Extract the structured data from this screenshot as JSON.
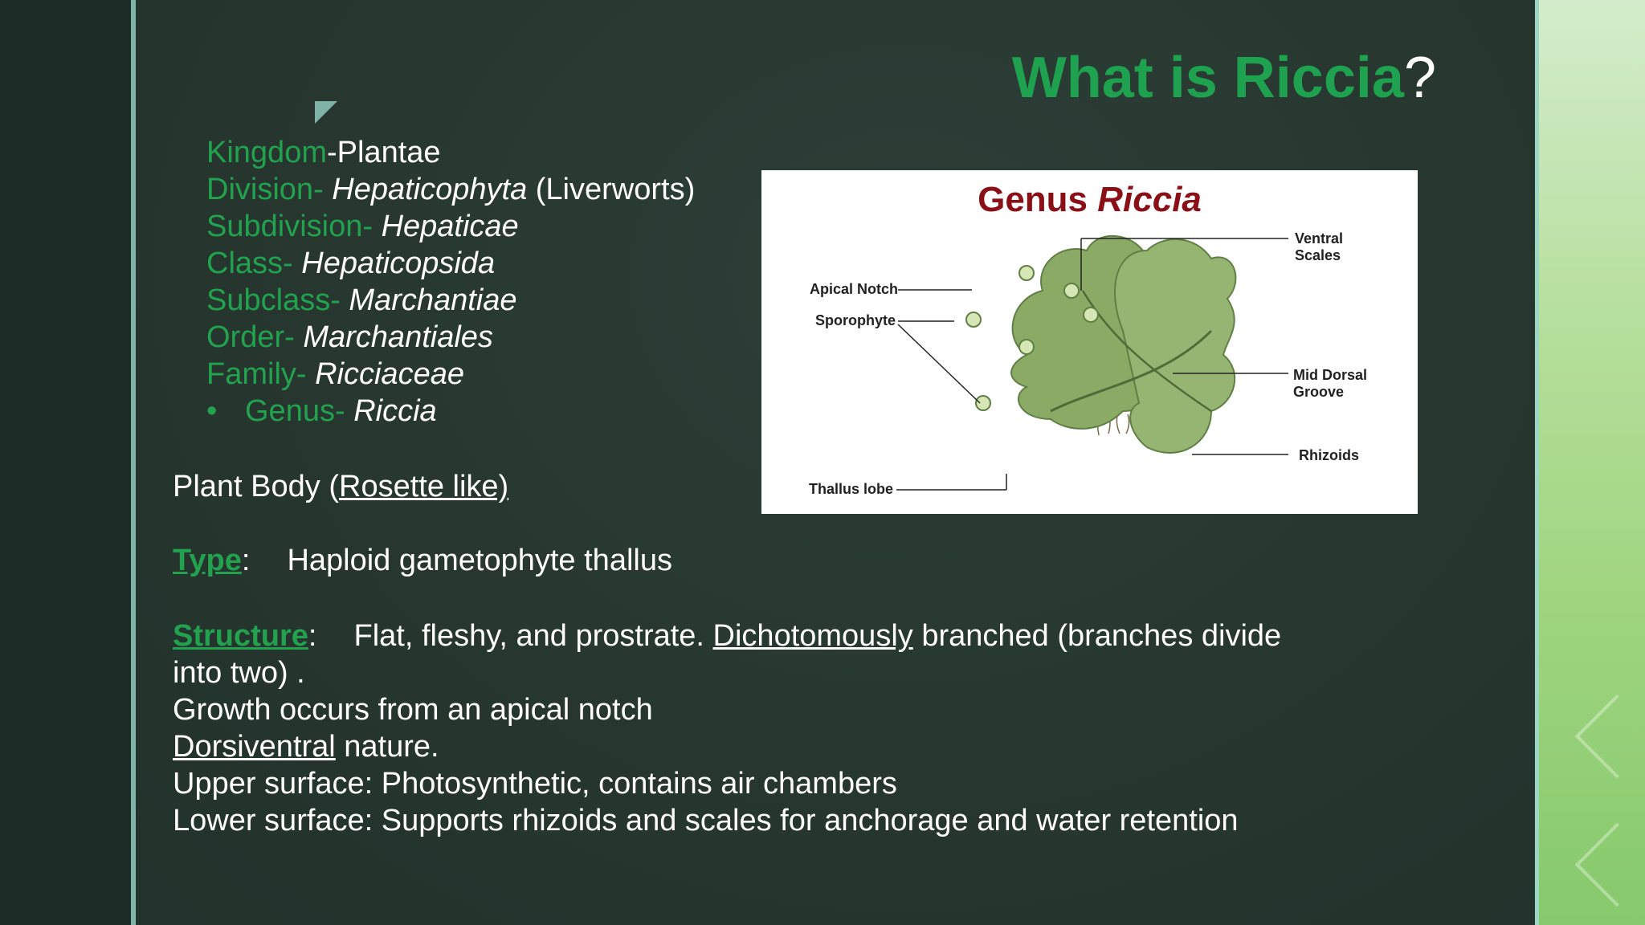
{
  "slide": {
    "title_main": "What is Riccia",
    "title_q": "?"
  },
  "taxonomy": [
    {
      "key": "Kingdom",
      "sep": "-",
      "value": "Plantae",
      "italic": false,
      "extra": ""
    },
    {
      "key": "Division-",
      "sep": " ",
      "value": "Hepaticophyta",
      "italic": true,
      "extra": " (Liverworts)"
    },
    {
      "key": "Subdivision-",
      "sep": " ",
      "value": "Hepaticae",
      "italic": true,
      "extra": ""
    },
    {
      "key": "Class-",
      "sep": " ",
      "value": "Hepaticopsida",
      "italic": true,
      "extra": ""
    },
    {
      "key": "Subclass-",
      "sep": " ",
      "value": "Marchantiae",
      "italic": true,
      "extra": ""
    },
    {
      "key": "Order-",
      "sep": " ",
      "value": "Marchantiales",
      "italic": true,
      "extra": ""
    },
    {
      "key": "Family-",
      "sep": " ",
      "value": "Ricciaceae",
      "italic": true,
      "extra": ""
    }
  ],
  "genus": {
    "bullet": "•",
    "key": "Genus-",
    "value": "Riccia"
  },
  "plant_body": {
    "prefix": "Plant Body (",
    "underlined": "Rosette like)"
  },
  "type": {
    "label": "Type",
    "colon": ":",
    "value": "Haploid gametophyte thallus"
  },
  "structure": {
    "label": "Structure",
    "colon": ":",
    "text1": "Flat, fleshy, and prostrate.",
    "underlined": "Dichotomously",
    "text2": " branched (branches divide",
    "text3": "into two) ."
  },
  "lines": {
    "growth": "Growth occurs from an apical notch",
    "dorsi_u": "Dorsiventral",
    "dorsi_rest": " nature.",
    "upper": "Upper surface: Photosynthetic, contains air chambers",
    "lower": "Lower surface: Supports rhizoids and scales for anchorage and water retention"
  },
  "figure": {
    "title_plain": "Genus ",
    "title_italic": "Riccia",
    "labels": {
      "apical_notch": "Apical Notch",
      "sporophyte": "Sporophyte",
      "thallus_lobe": "Thallus lobe",
      "ventral_1": "Ventral",
      "ventral_2": "Scales",
      "mid_dorsal_1": "Mid Dorsal",
      "mid_dorsal_2": "Groove",
      "rhizoids": "Rhizoids"
    }
  },
  "colors": {
    "accent_green": "#22a14f",
    "figure_title": "#8b0f16",
    "background": "#27372f"
  }
}
